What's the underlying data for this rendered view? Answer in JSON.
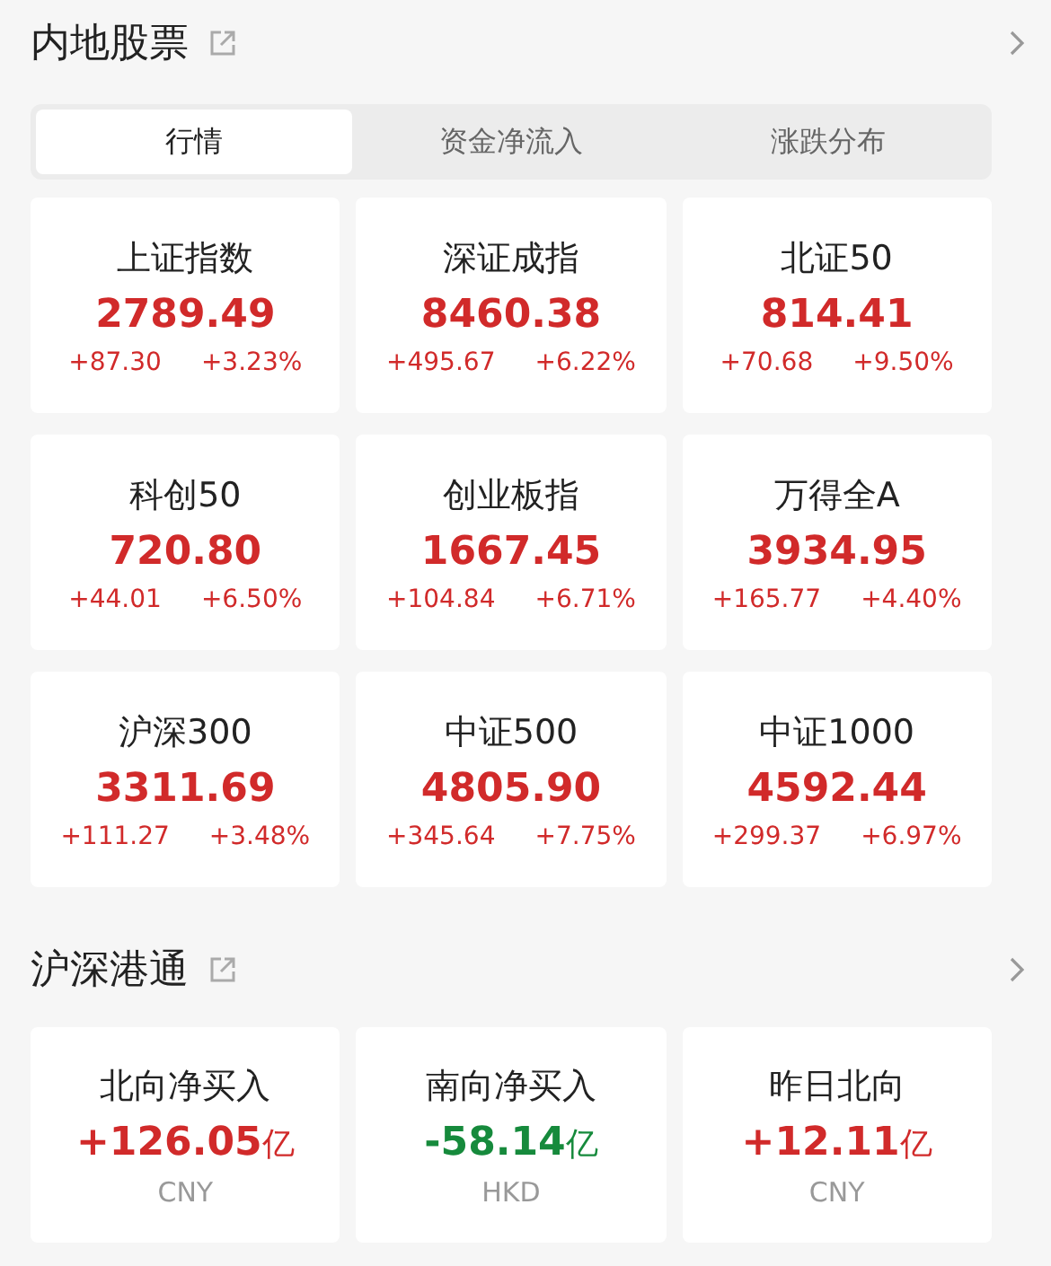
{
  "sections": [
    {
      "title": "内地股票",
      "tabs": [
        {
          "label": "行情",
          "selected": true
        },
        {
          "label": "资金净流入",
          "selected": false
        },
        {
          "label": "涨跌分布",
          "selected": false
        }
      ],
      "indices": [
        {
          "name": "上证指数",
          "value": "2789.49",
          "change": "+87.30",
          "percent": "+3.23%",
          "kind": "up"
        },
        {
          "name": "深证成指",
          "value": "8460.38",
          "change": "+495.67",
          "percent": "+6.22%",
          "kind": "up"
        },
        {
          "name": "北证50",
          "value": "814.41",
          "change": "+70.68",
          "percent": "+9.50%",
          "kind": "up"
        },
        {
          "name": "科创50",
          "value": "720.80",
          "change": "+44.01",
          "percent": "+6.50%",
          "kind": "up"
        },
        {
          "name": "创业板指",
          "value": "1667.45",
          "change": "+104.84",
          "percent": "+6.71%",
          "kind": "up"
        },
        {
          "name": "万得全A",
          "value": "3934.95",
          "change": "+165.77",
          "percent": "+4.40%",
          "kind": "up"
        },
        {
          "name": "沪深300",
          "value": "3311.69",
          "change": "+111.27",
          "percent": "+3.48%",
          "kind": "up"
        },
        {
          "name": "中证500",
          "value": "4805.90",
          "change": "+345.64",
          "percent": "+7.75%",
          "kind": "up"
        },
        {
          "name": "中证1000",
          "value": "4592.44",
          "change": "+299.37",
          "percent": "+6.97%",
          "kind": "up"
        }
      ]
    },
    {
      "title": "沪深港通",
      "flows": [
        {
          "name": "北向净买入",
          "value": "+126.05",
          "unit": "亿",
          "currency": "CNY",
          "kind": "up"
        },
        {
          "name": "南向净买入",
          "value": "-58.14",
          "unit": "亿",
          "currency": "HKD",
          "kind": "down"
        },
        {
          "name": "昨日北向",
          "value": "+12.11",
          "unit": "亿",
          "currency": "CNY",
          "kind": "up"
        }
      ]
    }
  ]
}
